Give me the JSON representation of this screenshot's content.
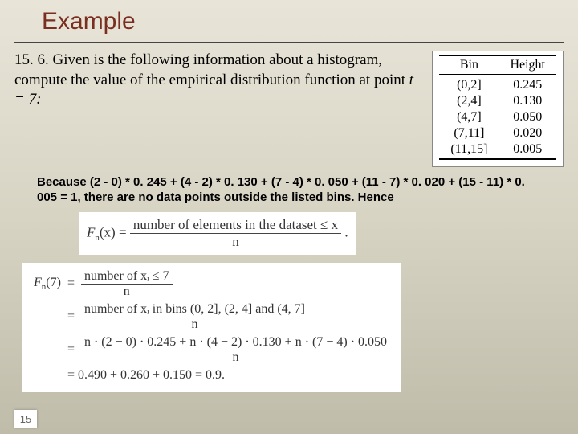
{
  "title": "Example",
  "question": {
    "lead": "15. 6. Given is the following information about a histogram, compute the value of the empirical distribution function at point ",
    "point": "t = 7:"
  },
  "table": {
    "headers": [
      "Bin",
      "Height"
    ],
    "rows": [
      [
        "(0,2]",
        "0.245"
      ],
      [
        "(2,4]",
        "0.130"
      ],
      [
        "(4,7]",
        "0.050"
      ],
      [
        "(7,11]",
        "0.020"
      ],
      [
        "(11,15]",
        "0.005"
      ]
    ]
  },
  "because": "Because (2 - 0) * 0. 245 + (4 - 2) * 0. 130 + (7 - 4) * 0. 050 + (11 - 7) * 0. 020 + (15 - 11) * 0. 005 = 1, there are no data points outside the listed bins. Hence",
  "formula1": {
    "lhs": "F",
    "sub": "n",
    "arg": "(x) = ",
    "num": "number of elements in the dataset ≤ x",
    "den": "n",
    "tail": "."
  },
  "formula2": {
    "lhs": "F",
    "sub": "n",
    "arg": "(7)",
    "r1num": "number of xᵢ ≤ 7",
    "r1den": "n",
    "r2num": "number of xᵢ in bins (0, 2], (2, 4] and (4, 7]",
    "r2den": "n",
    "r3num": "n · (2 − 0) · 0.245 + n · (4 − 2) · 0.130 + n · (7 − 4) · 0.050",
    "r3den": "n",
    "r4": "= 0.490 + 0.260 + 0.150 = 0.9."
  },
  "page": "15"
}
